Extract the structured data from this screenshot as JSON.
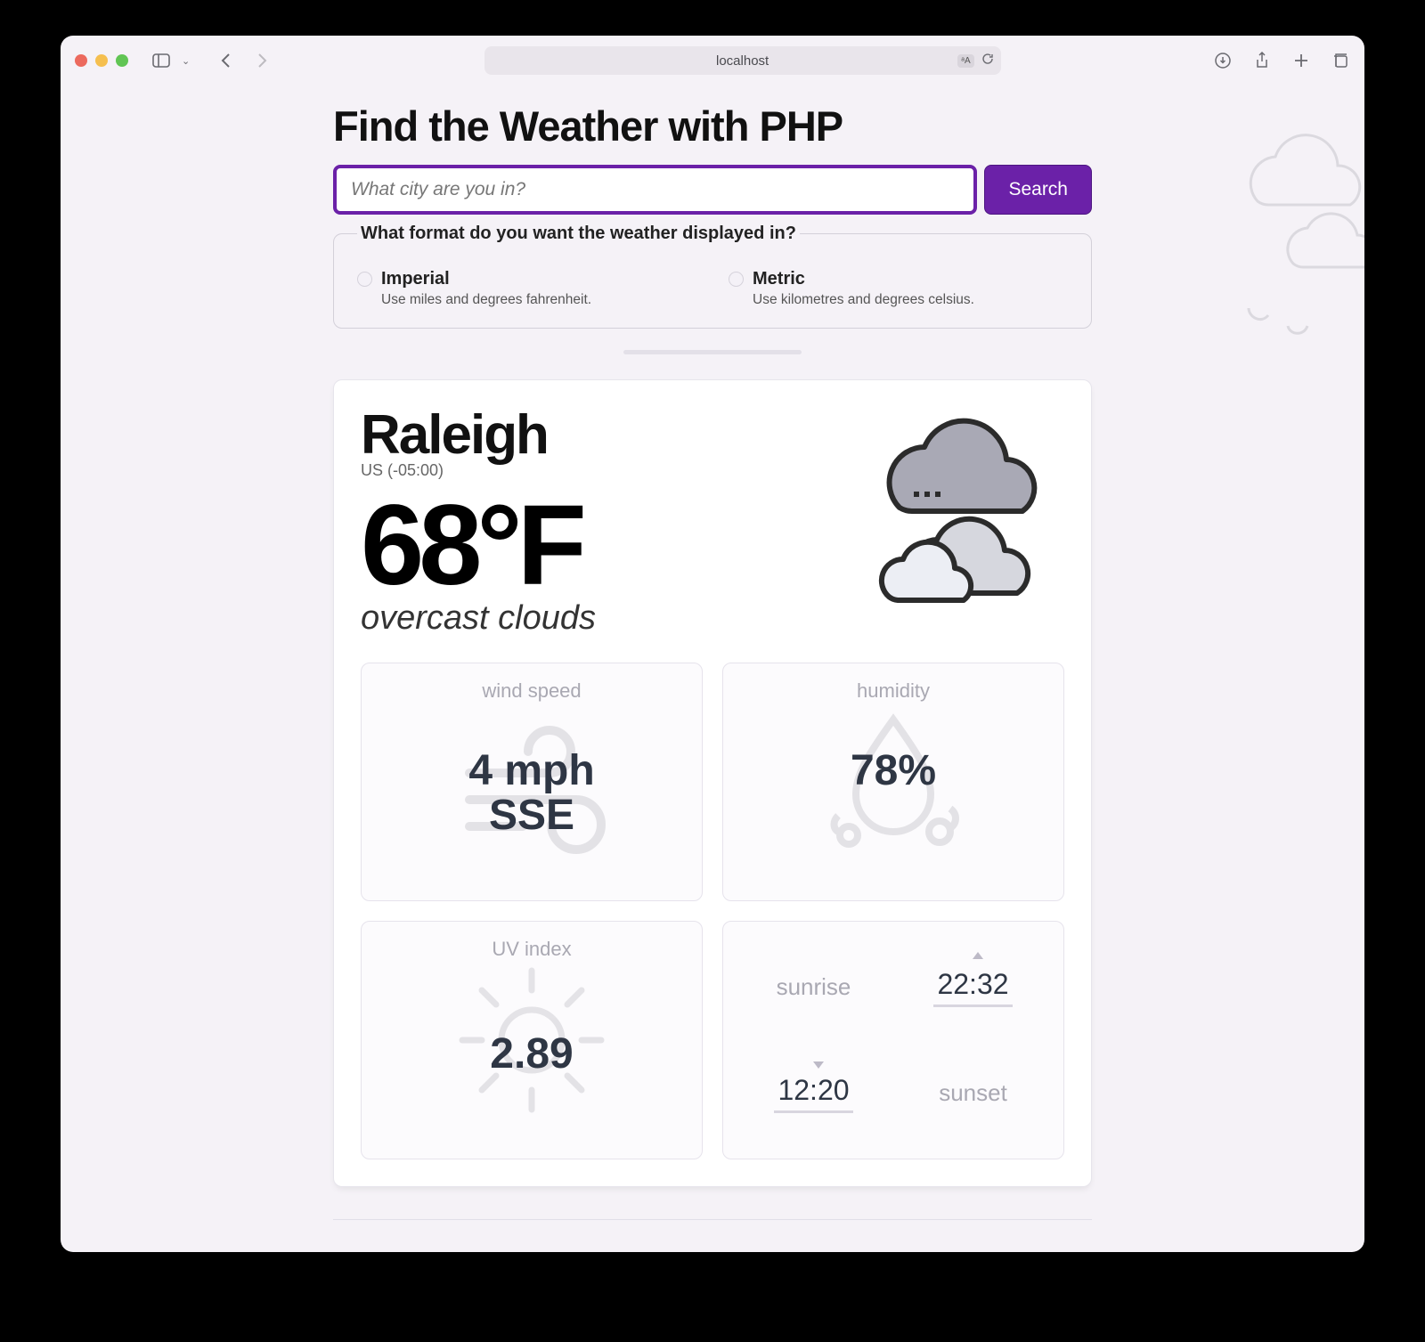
{
  "browser": {
    "url_display": "localhost"
  },
  "header": {
    "title": "Find the Weather with PHP"
  },
  "search": {
    "placeholder": "What city are you in?",
    "button_label": "Search"
  },
  "format": {
    "legend": "What format do you want the weather displayed in?",
    "options": [
      {
        "id": "imperial",
        "label": "Imperial",
        "description": "Use miles and degrees fahrenheit."
      },
      {
        "id": "metric",
        "label": "Metric",
        "description": "Use kilometres and degrees celsius."
      }
    ]
  },
  "weather": {
    "city": "Raleigh",
    "country_tz": "US (-05:00)",
    "temperature_display": "68°F",
    "conditions": "overcast clouds",
    "icon": "overcast-clouds-icon",
    "metrics": {
      "wind": {
        "title": "wind speed",
        "value": "4 mph",
        "direction": "SSE"
      },
      "humidity": {
        "title": "humidity",
        "value": "78%"
      },
      "uv": {
        "title": "UV index",
        "value": "2.89"
      },
      "sun": {
        "sunrise_label": "sunrise",
        "sunrise_time": "22:32",
        "sunset_label": "sunset",
        "sunset_time": "12:20"
      }
    }
  },
  "colors": {
    "accent_purple": "#6b21a8",
    "page_bg": "#f5f2f7"
  }
}
